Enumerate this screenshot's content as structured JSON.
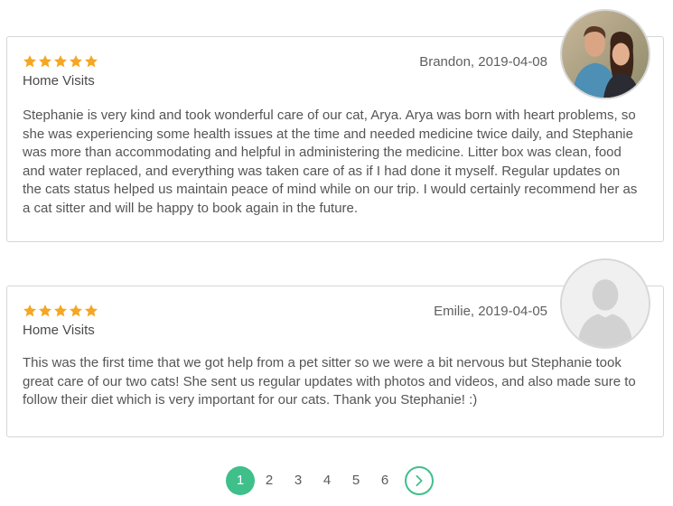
{
  "reviews": [
    {
      "rating": 5,
      "author_date": "Brandon, 2019-04-08",
      "service": "Home Visits",
      "text": "Stephanie is very kind and took wonderful care of our cat, Arya. Arya was born with heart problems, so she was experiencing some health issues at the time and needed medicine twice daily, and Stephanie was more than accommodating and helpful in administering the medicine. Litter box was clean, food and water replaced, and everything was taken care of as if I had done it myself. Regular updates on the cats status helped us maintain peace of mind while on our trip. I would certainly recommend her as a cat sitter and will be happy to book again in the future.",
      "avatar": "couple-photo"
    },
    {
      "rating": 5,
      "author_date": "Emilie, 2019-04-05",
      "service": "Home Visits",
      "text": "This was the first time that we got help from a pet sitter so we were a bit nervous but Stephanie took great care of our two cats! She sent us regular updates with photos and videos, and also made sure to follow their diet which is very important for our cats. Thank you Stephanie! :)",
      "avatar": "default-avatar-placeholder"
    }
  ],
  "pagination": {
    "pages": [
      "1",
      "2",
      "3",
      "4",
      "5",
      "6"
    ],
    "current": "1",
    "next_icon": "chevron-right-icon"
  },
  "colors": {
    "star": "#f5a623",
    "accent": "#3fbf8a",
    "border": "#d6d6d6"
  }
}
